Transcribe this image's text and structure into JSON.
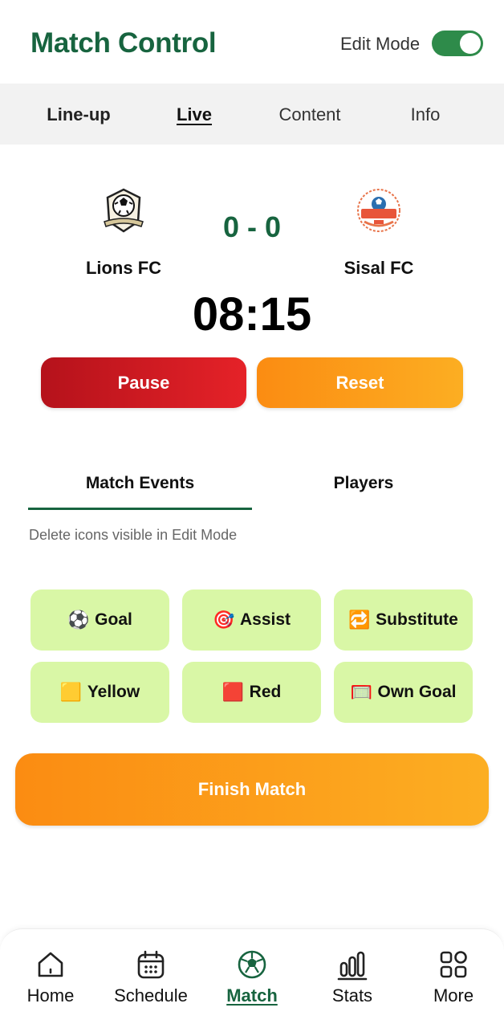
{
  "header": {
    "title": "Match Control",
    "edit_mode_label": "Edit Mode",
    "edit_mode_on": true
  },
  "tabs": [
    {
      "label": "Line-up"
    },
    {
      "label": "Live",
      "active": true
    },
    {
      "label": "Content"
    },
    {
      "label": "Info"
    }
  ],
  "match": {
    "home": {
      "name": "Lions FC",
      "logo_icon": "soccer-shield-logo"
    },
    "away": {
      "name": "Sisal FC",
      "logo_icon": "football-club-badge-logo"
    },
    "score": "0 - 0",
    "clock": "08:15"
  },
  "controls": {
    "pause_label": "Pause",
    "reset_label": "Reset"
  },
  "subtabs": [
    {
      "label": "Match Events",
      "active": true
    },
    {
      "label": "Players"
    }
  ],
  "hint": "Delete icons visible in Edit Mode",
  "events": [
    {
      "icon": "⚽",
      "label": "Goal"
    },
    {
      "icon": "🎯",
      "label": "Assist"
    },
    {
      "icon": "🔁",
      "label": "Substitute"
    },
    {
      "icon": "🟨",
      "label": "Yellow"
    },
    {
      "icon": "🟥",
      "label": "Red"
    },
    {
      "icon": "🥅",
      "label": "Own Goal"
    }
  ],
  "finish_label": "Finish Match",
  "nav": [
    {
      "label": "Home",
      "icon": "home-icon"
    },
    {
      "label": "Schedule",
      "icon": "calendar-icon"
    },
    {
      "label": "Match",
      "icon": "soccer-ball-icon",
      "active": true
    },
    {
      "label": "Stats",
      "icon": "bar-chart-icon"
    },
    {
      "label": "More",
      "icon": "grid-icon"
    }
  ],
  "colors": {
    "brand_green": "#17643f",
    "pause_red": "#d11a22",
    "orange": "#fb9a18",
    "event_bg": "#d9f7a6"
  }
}
